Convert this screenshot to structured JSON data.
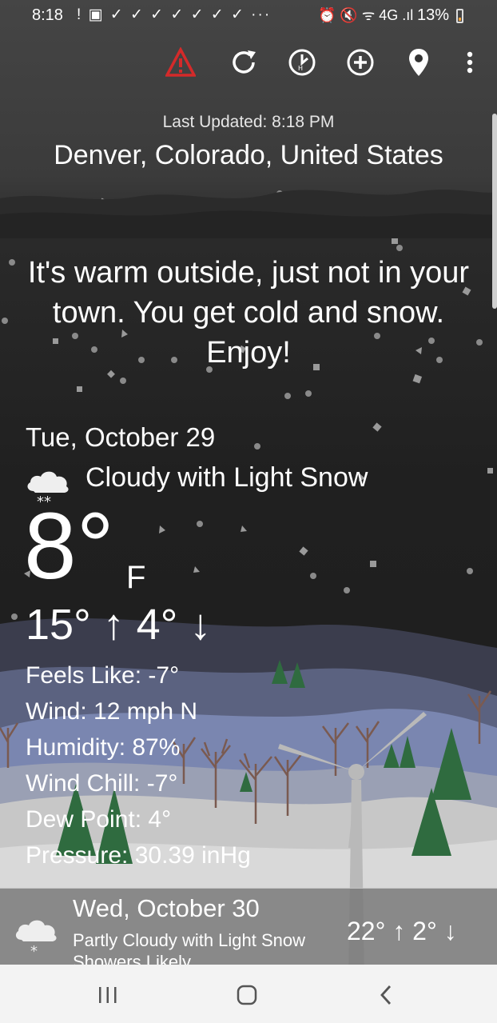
{
  "status_bar": {
    "time": "8:18",
    "left_icons": "! ▣ ✓ ✓ ✓ ✓ ✓ ✓ ✓ ···",
    "right_icons": "⏰ 🔇 ᯤ 4G .ıl",
    "battery": "13%"
  },
  "toolbar": {
    "icons": [
      "alert-icon",
      "refresh-icon",
      "history-icon",
      "add-location-icon",
      "location-pin-icon",
      "more-vert-icon"
    ],
    "alert_color": "#d42a2a"
  },
  "header": {
    "last_updated": "Last Updated: 8:18 PM",
    "location": "Denver, Colorado, United States"
  },
  "quote": {
    "text": "It's warm outside, just not in your town. You get cold and snow. Enjoy!"
  },
  "today": {
    "date": "Tue, October 29",
    "condition": "Cloudy with Light Snow",
    "condition_icon": "cloud-snow-icon",
    "temperature": "8°",
    "unit": "F",
    "hilo": "15° ↑ 4° ↓",
    "details": {
      "feels_like": "Feels Like: -7°",
      "wind": "Wind: 12 mph N",
      "humidity": "Humidity: 87%",
      "wind_chill": "Wind Chill: -7°",
      "dew_point": "Dew Point: 4°",
      "pressure": "Pressure: 30.39 inHg"
    }
  },
  "forecast": [
    {
      "date": "Wed, October 30",
      "condition": "Partly Cloudy with Light Snow Showers Likely",
      "icon": "cloud-snow-icon",
      "hilo": "22° ↑  2° ↓"
    }
  ],
  "nav": {
    "icons": [
      "recent-apps-icon",
      "home-icon",
      "back-icon"
    ]
  }
}
